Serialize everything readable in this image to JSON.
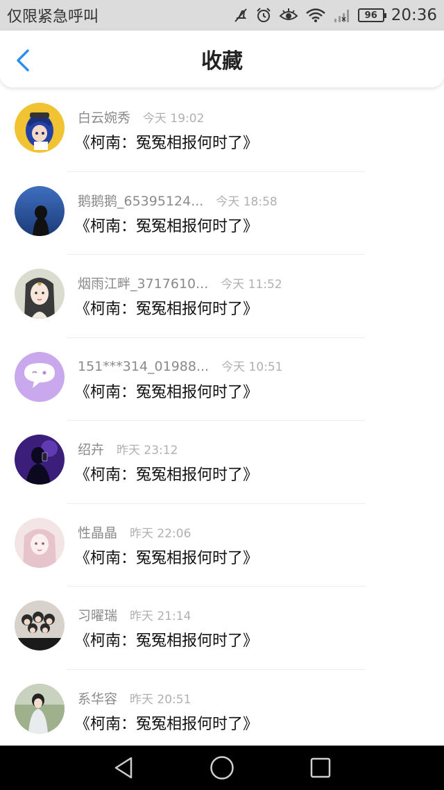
{
  "status_bar": {
    "carrier": "仅限紧急呼叫",
    "battery": "96",
    "time": "20:36",
    "icons": [
      "mute-icon",
      "alarm-icon",
      "eye-icon",
      "wifi-icon",
      "signal-icon",
      "battery-icon"
    ]
  },
  "header": {
    "title": "收藏",
    "back_icon": "chevron-left-icon",
    "accent": "#2b8ff0"
  },
  "items": [
    {
      "name": "白云婉秀",
      "time": "今天 19:02",
      "title": "《柯南：冤冤相报何时了》"
    },
    {
      "name": "鹅鹅鹅_65395124...",
      "time": "今天 18:58",
      "title": "《柯南：冤冤相报何时了》"
    },
    {
      "name": "烟雨江畔_3717610...",
      "time": "今天 11:52",
      "title": "《柯南：冤冤相报何时了》"
    },
    {
      "name": "151***314_01988...",
      "time": "今天 10:51",
      "title": "《柯南：冤冤相报何时了》"
    },
    {
      "name": "绍卉",
      "time": "昨天 23:12",
      "title": "《柯南：冤冤相报何时了》"
    },
    {
      "name": "性晶晶",
      "time": "昨天 22:06",
      "title": "《柯南：冤冤相报何时了》"
    },
    {
      "name": "习曜瑞",
      "time": "昨天 21:14",
      "title": "《柯南：冤冤相报何时了》"
    },
    {
      "name": "系华容",
      "time": "昨天 20:51",
      "title": "《柯南：冤冤相报何时了》"
    }
  ],
  "system_nav": {
    "icons": [
      "back-triangle-icon",
      "home-circle-icon",
      "recents-square-icon"
    ]
  }
}
